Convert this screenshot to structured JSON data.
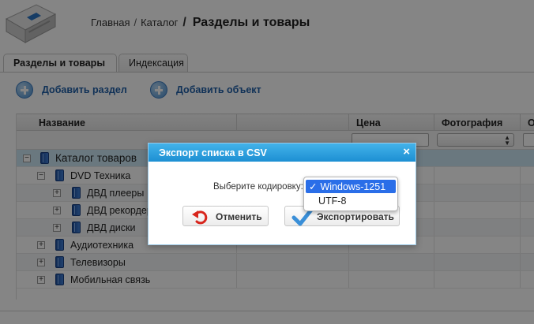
{
  "breadcrumb": {
    "home": "Главная",
    "separator": "/",
    "catalog": "Каталог",
    "current": "Разделы и товары"
  },
  "tabs": [
    {
      "label": "Разделы и товары",
      "active": true
    },
    {
      "label": "Индексация",
      "active": false
    }
  ],
  "toolbar": {
    "add_section": "Добавить раздел",
    "add_object": "Добавить объект"
  },
  "table": {
    "columns": [
      "Название",
      "",
      "Цена",
      "Фотография",
      "О"
    ],
    "rows": [
      {
        "label": "Каталог товаров",
        "expander": "−",
        "level": 0
      },
      {
        "label": "DVD Техника",
        "expander": "−",
        "level": 1
      },
      {
        "label": "ДВД плееры",
        "expander": "+",
        "level": 2
      },
      {
        "label": "ДВД рекордер",
        "expander": "+",
        "level": 2
      },
      {
        "label": "ДВД диски",
        "expander": "+",
        "level": 2
      },
      {
        "label": "Аудиотехника",
        "expander": "+",
        "level": 1
      },
      {
        "label": "Телевизоры",
        "expander": "+",
        "level": 1
      },
      {
        "label": "Мобильная связь",
        "expander": "+",
        "level": 1
      }
    ]
  },
  "dialog": {
    "title": "Экспорт списка в CSV",
    "close": "×",
    "encoding_label": "Выберите кодировку:",
    "encoding_options": [
      "Windows-1251",
      "UTF-8"
    ],
    "encoding_selected": "Windows-1251",
    "check_mark": "✓",
    "cancel_label": "Отменить",
    "export_label": "Экспортировать"
  },
  "colors": {
    "accent": "#1d8fd3",
    "link": "#1f5fa8",
    "selected_option": "#2a6ee8"
  },
  "icons": [
    "catalog-logo-icon",
    "plus-icon",
    "book-icon",
    "undo-icon",
    "checkmark-icon",
    "close-icon"
  ]
}
